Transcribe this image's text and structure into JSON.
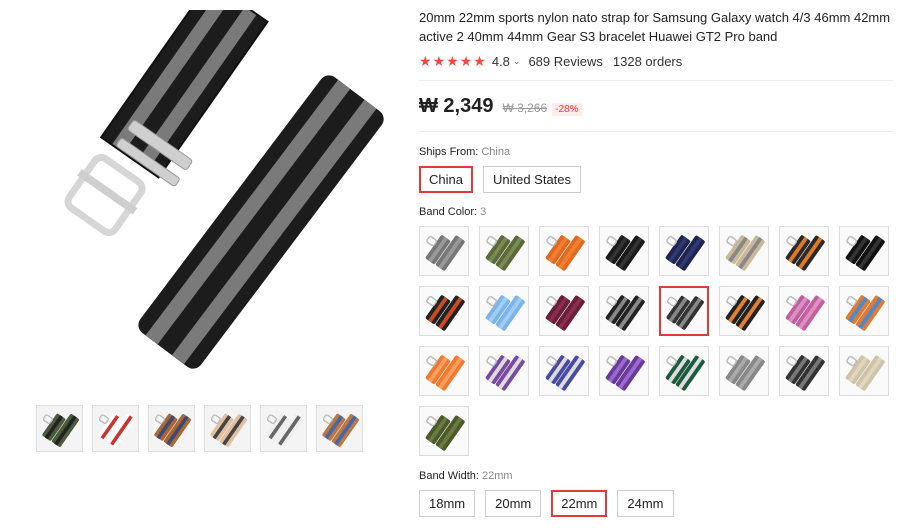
{
  "product": {
    "title": "20mm 22mm sports nylon nato strap for Samsung Galaxy watch 4/3 46mm 42mm active 2 40mm 44mm Gear S3 bracelet Huawei GT2 Pro band",
    "rating": "4.8",
    "reviews": "689 Reviews",
    "orders": "1328 orders",
    "stars": 5
  },
  "price": {
    "current": "₩ 2,349",
    "original": "₩ 3,266",
    "discount": "-28%"
  },
  "ships_from": {
    "label": "Ships From: ",
    "value": "China",
    "options": [
      "China",
      "United States"
    ],
    "selected_index": 0
  },
  "band_color": {
    "label": "Band Color: ",
    "value": "3",
    "selected_index": 12,
    "swatches": [
      {
        "name": "grey",
        "c1": "#777",
        "c2": "#999"
      },
      {
        "name": "army-green",
        "c1": "#5a6b3a",
        "c2": "#7b8a55"
      },
      {
        "name": "orange",
        "c1": "#e06a20",
        "c2": "#f08030"
      },
      {
        "name": "black",
        "c1": "#1a1a1a",
        "c2": "#333"
      },
      {
        "name": "navy",
        "c1": "#1d2550",
        "c2": "#2e3a70"
      },
      {
        "name": "beige-grey",
        "c1": "#c9b99a",
        "c2": "#888"
      },
      {
        "name": "black-orange",
        "c1": "#2a2a2a",
        "c2": "#e07a20"
      },
      {
        "name": "black-2",
        "c1": "#111",
        "c2": "#333"
      },
      {
        "name": "black-red-stripe",
        "c1": "#222",
        "c2": "#d04a20"
      },
      {
        "name": "light-blue",
        "c1": "#7ab4e8",
        "c2": "#a0cdf0"
      },
      {
        "name": "burgundy",
        "c1": "#6a1e3a",
        "c2": "#8a2e4e"
      },
      {
        "name": "black-grey-stripe",
        "c1": "#222",
        "c2": "#888"
      },
      {
        "name": "black-grey",
        "c1": "#333",
        "c2": "#888"
      },
      {
        "name": "black-orange-2",
        "c1": "#222",
        "c2": "#e08030"
      },
      {
        "name": "pink-purple",
        "c1": "#c060a0",
        "c2": "#e090c0"
      },
      {
        "name": "rainbow",
        "c1": "#e07a30",
        "c2": "#4a8ad0"
      },
      {
        "name": "orange-2",
        "c1": "#f07a30",
        "c2": "#f8a060"
      },
      {
        "name": "purple-stripe",
        "c1": "#7a4aa0",
        "c2": "#ddd"
      },
      {
        "name": "blue-purple",
        "c1": "#4a4aa0",
        "c2": "#ddd"
      },
      {
        "name": "purple",
        "c1": "#6a3a9a",
        "c2": "#9a6ad0"
      },
      {
        "name": "green-white",
        "c1": "#1d5a40",
        "c2": "#ddd"
      },
      {
        "name": "grey-2",
        "c1": "#888",
        "c2": "#aaa"
      },
      {
        "name": "dark-grey",
        "c1": "#333",
        "c2": "#777"
      },
      {
        "name": "khaki",
        "c1": "#d0c4a8",
        "c2": "#e0d6c0"
      },
      {
        "name": "olive",
        "c1": "#4a5a2a",
        "c2": "#6a7a40"
      }
    ]
  },
  "band_width": {
    "label": "Band Width: ",
    "value": "22mm",
    "options": [
      "18mm",
      "20mm",
      "22mm",
      "24mm"
    ],
    "selected_index": 2
  },
  "thumbnails": [
    {
      "name": "watch-green",
      "c1": "#4a5a3a",
      "c2": "#222"
    },
    {
      "name": "size-chart",
      "c1": "#fff",
      "c2": "#d03030"
    },
    {
      "name": "straps-variety",
      "c1": "#aa6633",
      "c2": "#3a4a7a"
    },
    {
      "name": "wrist-photo",
      "c1": "#e0c0a0",
      "c2": "#444"
    },
    {
      "name": "tools",
      "c1": "#eee",
      "c2": "#666"
    },
    {
      "name": "straps-collage",
      "c1": "#bb7744",
      "c2": "#4466aa"
    }
  ]
}
